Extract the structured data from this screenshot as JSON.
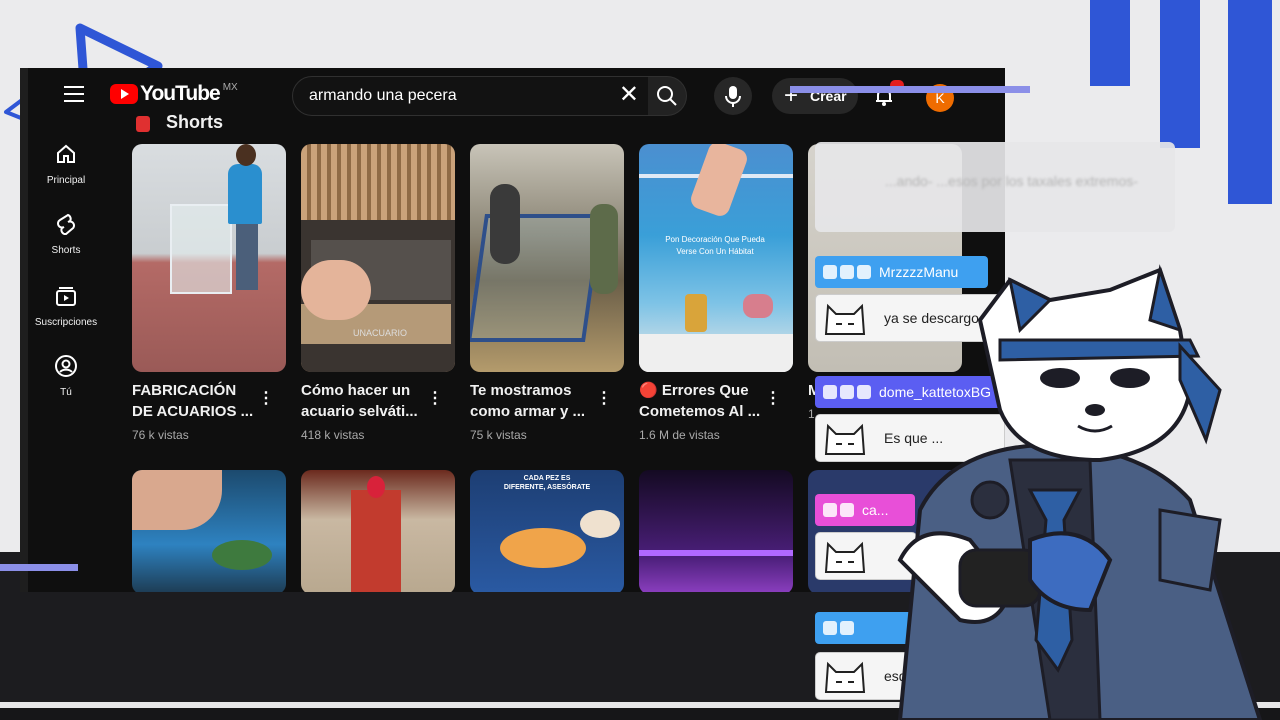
{
  "app": {
    "logo_text": "YouTube",
    "region": "MX",
    "search_query": "armando una pecera",
    "create_label": "Crear",
    "avatar_initial": "K"
  },
  "guide": [
    {
      "label": "Principal",
      "icon": "home-icon"
    },
    {
      "label": "Shorts",
      "icon": "shorts-icon"
    },
    {
      "label": "Suscripciones",
      "icon": "subscriptions-icon"
    },
    {
      "label": "Tú",
      "icon": "you-icon"
    }
  ],
  "section_title": "Shorts",
  "shorts": [
    {
      "title": "FABRICACIÓN DE ACUARIOS ...",
      "views": "76 k vistas"
    },
    {
      "title": "Cómo hacer un acuario selváti...",
      "views": "418 k vistas"
    },
    {
      "title": "Te mostramos como armar y ...",
      "views": "75 k vistas"
    },
    {
      "title": "🔴 Errores Que Cometemos Al ...",
      "views": "1.6 M de vistas"
    },
    {
      "title": "M",
      "views": "1"
    }
  ],
  "thumb_texts": {
    "short2_watermark": "UNACUARIO",
    "short4_caption": "Pon Decoración Que Pueda Verse Con Un Hábitat",
    "row2_3_caption": "CADA PEZ ES DIFERENTE, ASESÓRATE"
  },
  "chat": {
    "top_message": "...ando- ...esos por los taxales extremos-",
    "entries": [
      {
        "user": "MrzzzzManu",
        "message": "ya se descargo",
        "color": "#3ea0f0"
      },
      {
        "user": "dome_kattetoxBG",
        "message": "Es que ...",
        "color": "#5b5ef2"
      },
      {
        "user": "ca...",
        "message": "",
        "color": "#e84fd8"
      },
      {
        "user": "",
        "message": "esque",
        "color": "#3ea0f0"
      }
    ]
  },
  "colors": {
    "accent_blue": "#2f56d6",
    "line_purple": "#8b8fe8",
    "yt_bg": "#0f0f0f"
  }
}
